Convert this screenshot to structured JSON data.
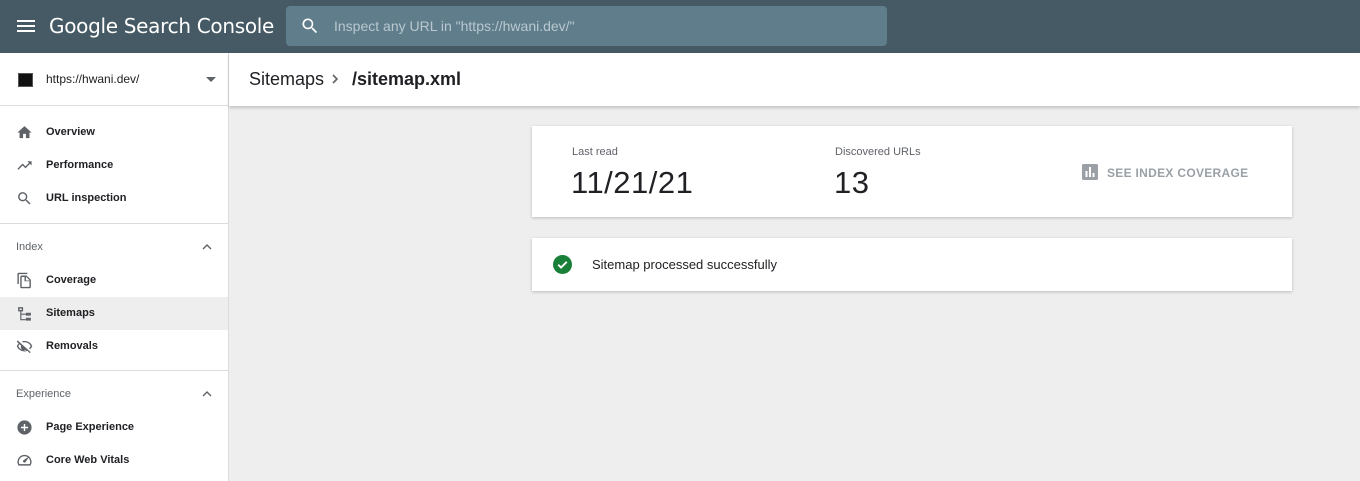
{
  "app": {
    "brand": "Google Search Console"
  },
  "search": {
    "placeholder": "Inspect any URL in \"https://hwani.dev/\""
  },
  "property": {
    "label": "https://hwani.dev/"
  },
  "sidebar": {
    "top_items": [
      {
        "label": "Overview",
        "icon": "home-icon"
      },
      {
        "label": "Performance",
        "icon": "trending-up-icon"
      },
      {
        "label": "URL inspection",
        "icon": "search-icon"
      }
    ],
    "sections": [
      {
        "title": "Index",
        "items": [
          {
            "label": "Coverage",
            "icon": "file-copy-icon"
          },
          {
            "label": "Sitemaps",
            "icon": "sitemap-icon",
            "active": true
          },
          {
            "label": "Removals",
            "icon": "visibility-off-icon"
          }
        ]
      },
      {
        "title": "Experience",
        "items": [
          {
            "label": "Page Experience",
            "icon": "add-circle-icon"
          },
          {
            "label": "Core Web Vitals",
            "icon": "speed-icon"
          }
        ]
      }
    ]
  },
  "breadcrumb": {
    "root": "Sitemaps",
    "current": "/sitemap.xml"
  },
  "stats": {
    "last_read_label": "Last read",
    "last_read_value": "11/21/21",
    "discovered_label": "Discovered URLs",
    "discovered_value": "13",
    "coverage_link": "SEE INDEX COVERAGE"
  },
  "status": {
    "message": "Sitemap processed successfully",
    "state": "success"
  },
  "colors": {
    "topbar": "#455a64",
    "search_bg": "#607d8b",
    "success": "#188038",
    "active_nav": "#eeeeee"
  }
}
